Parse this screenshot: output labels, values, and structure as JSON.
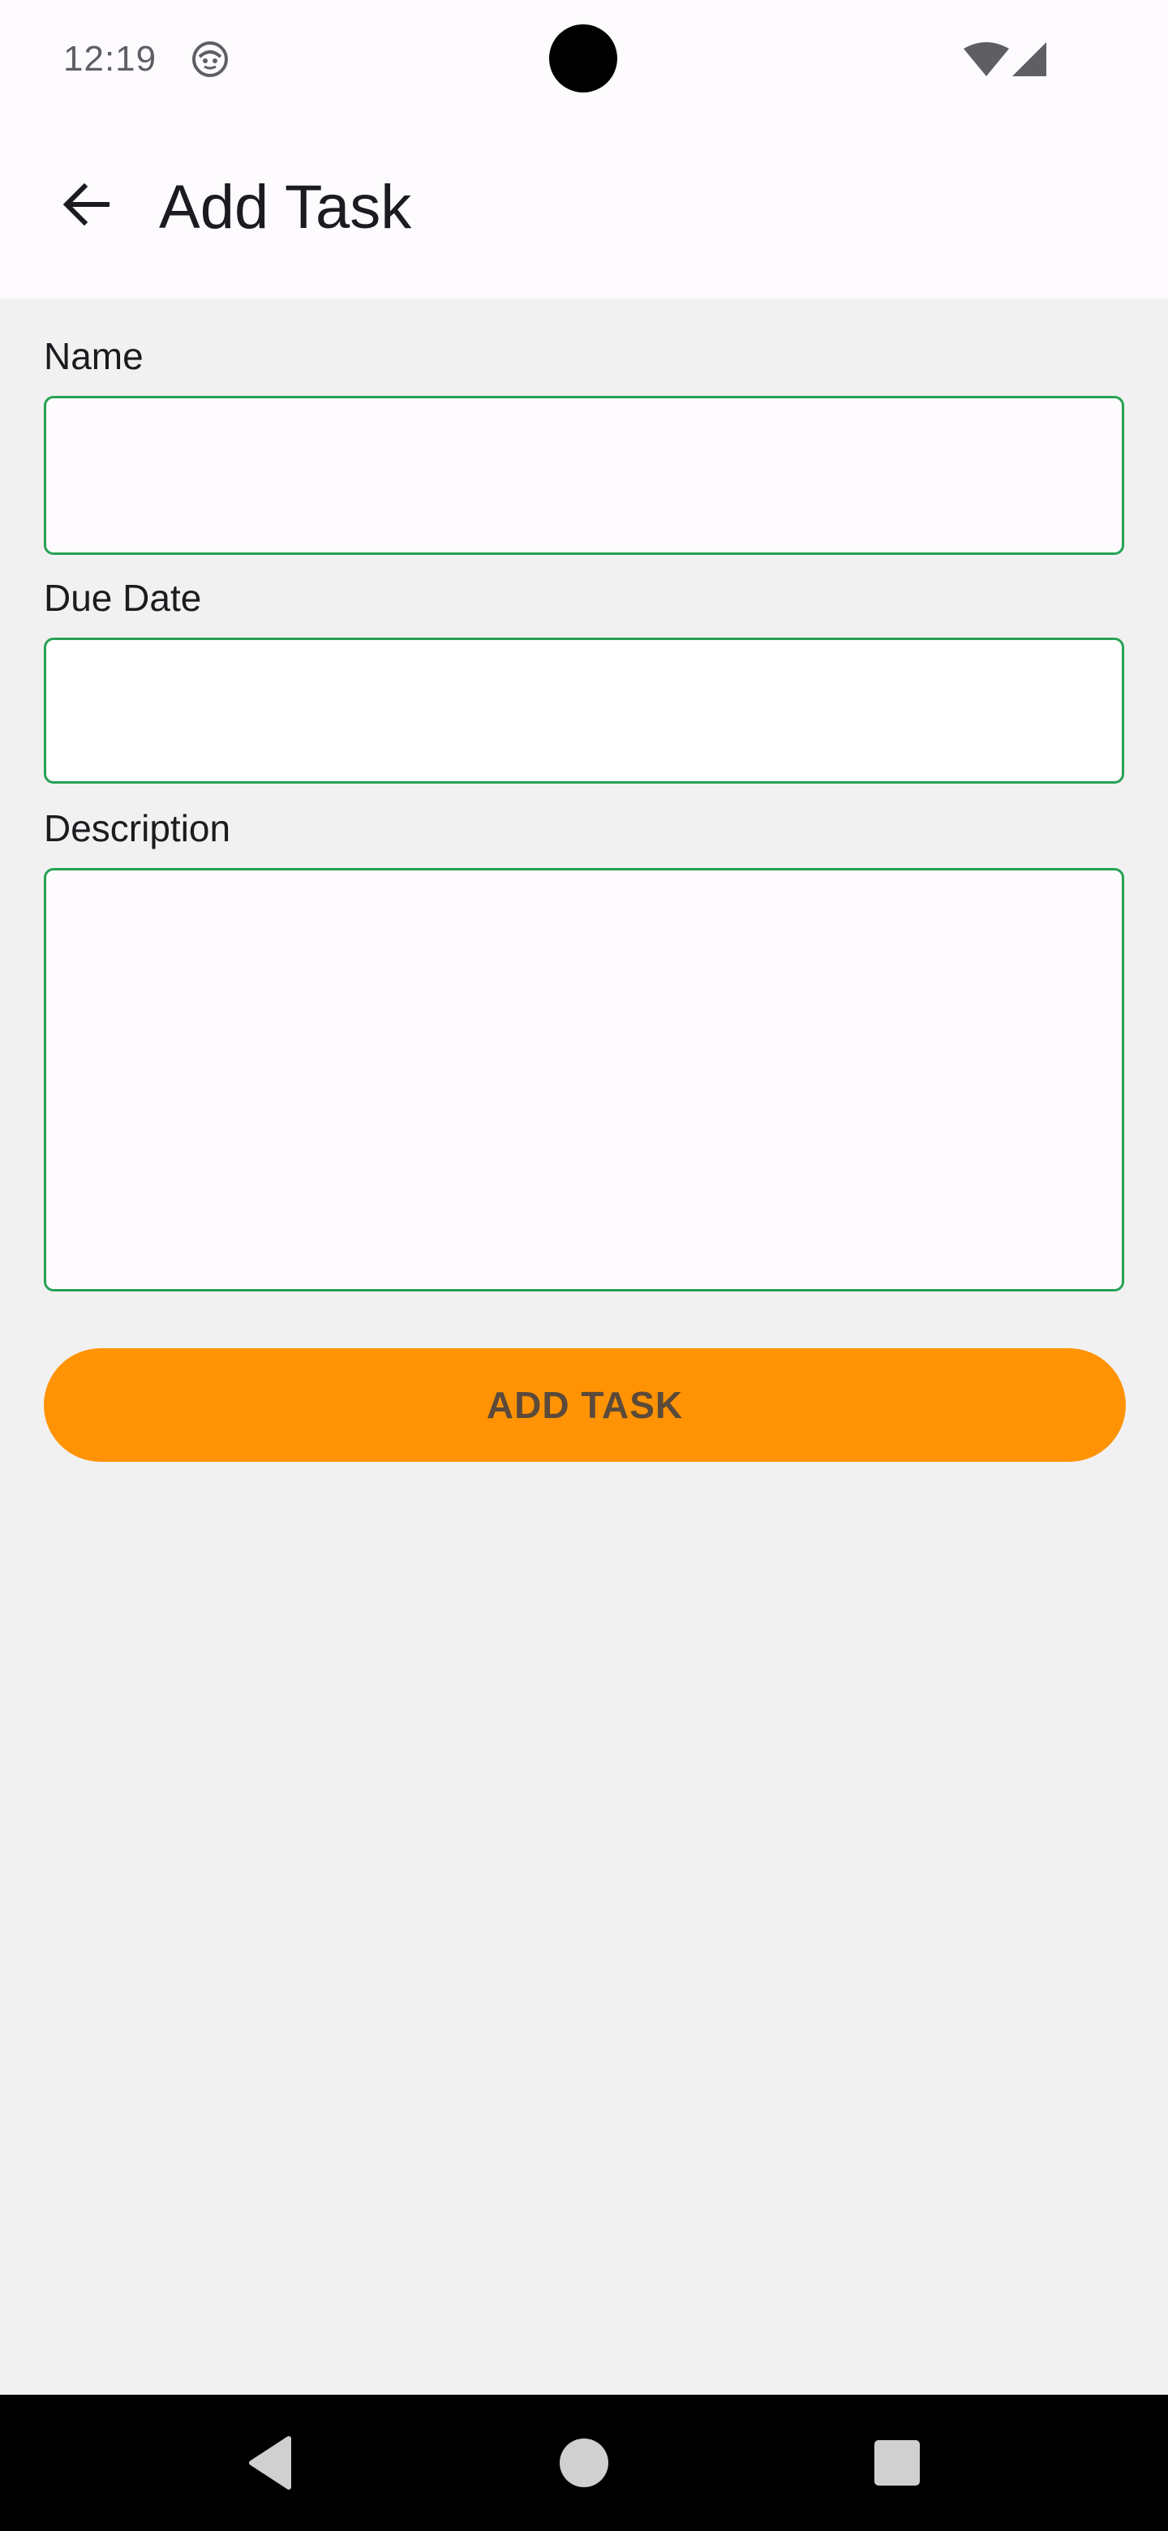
{
  "status_bar": {
    "time": "12:19"
  },
  "app_bar": {
    "title": "Add Task"
  },
  "form": {
    "name_label": "Name",
    "name_value": "",
    "due_date_label": "Due Date",
    "due_date_value": "",
    "description_label": "Description",
    "description_value": "",
    "submit_label": "ADD TASK"
  },
  "colors": {
    "field_border": "#26a155",
    "button_bg": "#ff9304",
    "button_text": "#5b4a3a",
    "screen_bg": "#f1f1f1",
    "bar_bg": "#fefbff"
  },
  "icons": {
    "status_app": "android-face-icon",
    "wifi": "wifi-icon",
    "signal": "cell-signal-icon",
    "back": "arrow-back-icon",
    "nav_back": "nav-back-icon",
    "nav_home": "nav-home-icon",
    "nav_recents": "nav-recents-icon"
  }
}
